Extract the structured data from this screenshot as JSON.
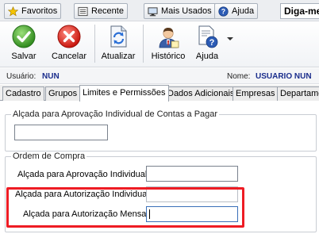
{
  "quickbar": {
    "favorites_label": "Favoritos",
    "recent_label": "Recente",
    "most_used_label": "Mais Usados",
    "help_label": "Ajuda",
    "search_text": "Diga-me"
  },
  "toolbar": {
    "save_label": "Salvar",
    "cancel_label": "Cancelar",
    "refresh_label": "Atualizar",
    "history_label": "Histórico",
    "help_label": "Ajuda"
  },
  "user": {
    "user_label": "Usuário:",
    "user_value": "NUN",
    "name_label": "Nome:",
    "name_value": "USUARIO NUN"
  },
  "tabs": [
    {
      "label": "Cadastro",
      "active": false
    },
    {
      "label": "Grupos",
      "active": false
    },
    {
      "label": "Limites e Permissões",
      "active": true
    },
    {
      "label": "Dados Adicionais",
      "active": false
    },
    {
      "label": "Empresas",
      "active": false
    },
    {
      "label": "Departame",
      "active": false
    }
  ],
  "content": {
    "accounts_payable_group": {
      "title": "Alçada para Aprovação Individual de Contas a Pagar",
      "value": ""
    },
    "purchase_order_group": {
      "title": "Ordem de Compra",
      "fields": [
        {
          "label": "Alçada para Aprovação Individual:",
          "value": ""
        },
        {
          "label": "Alçada para Autorização Individual:",
          "value": ""
        },
        {
          "label": "Alçada para Autorização Mensal:",
          "value": ""
        }
      ]
    }
  },
  "colors": {
    "highlight": "#ee1c24",
    "user_value": "#1a2d8c"
  }
}
